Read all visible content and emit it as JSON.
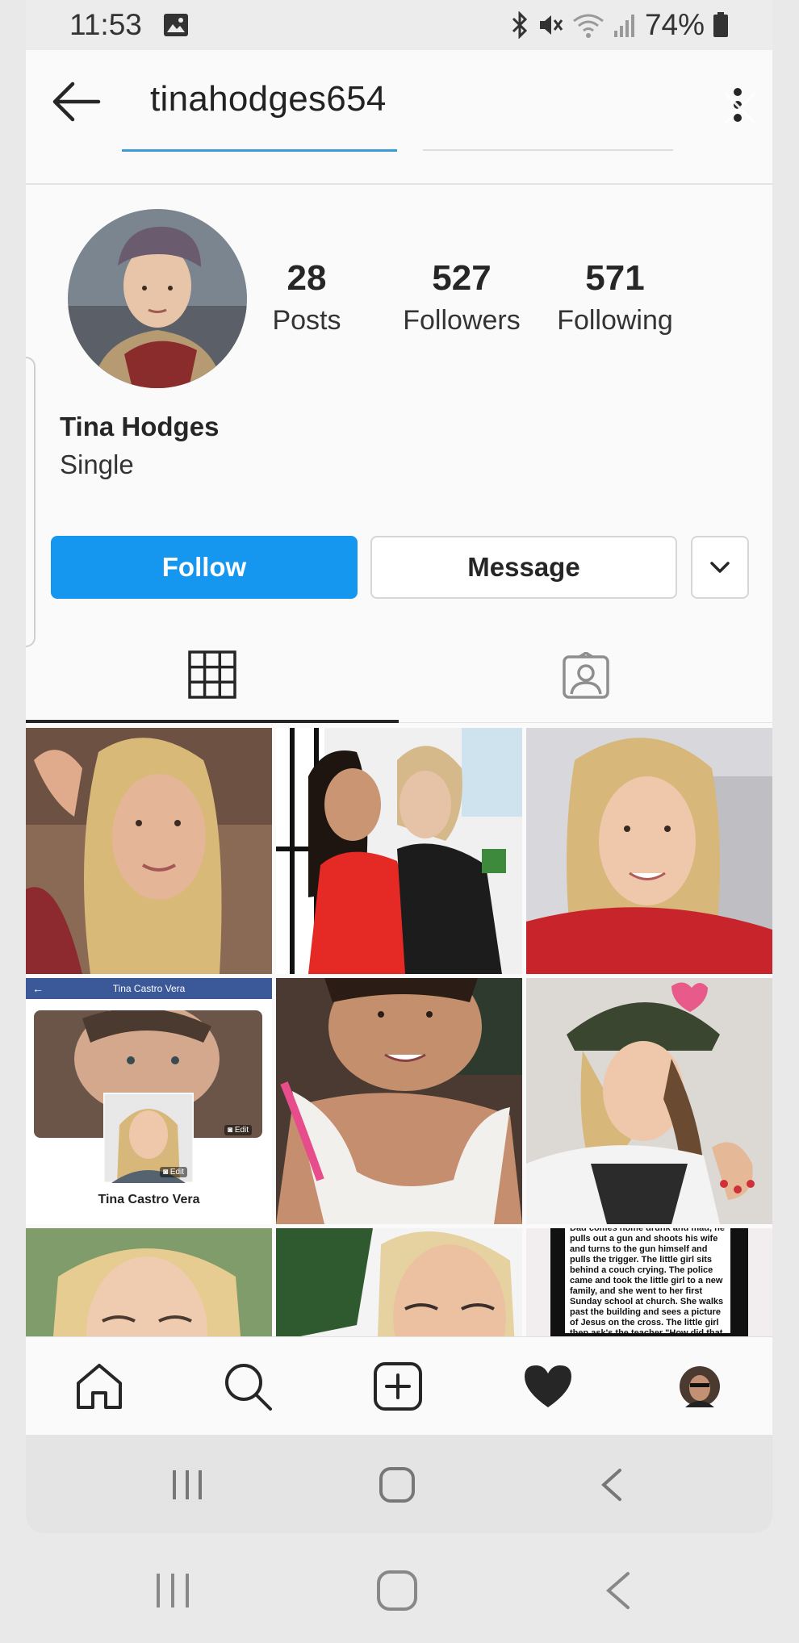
{
  "status_bar": {
    "time": "11:53",
    "battery": "74%"
  },
  "header": {
    "username": "tinahodges654"
  },
  "profile": {
    "name": "Tina Hodges",
    "bio": "Single",
    "stats": [
      {
        "value": "28",
        "label": "Posts"
      },
      {
        "value": "527",
        "label": "Followers"
      },
      {
        "value": "571",
        "label": "Following"
      }
    ]
  },
  "actions": {
    "follow_label": "Follow",
    "message_label": "Message"
  },
  "tabs": [
    "grid-icon",
    "tagged-icon"
  ],
  "posts": {
    "post4_header": "Tina Castro Vera",
    "post4_caption": "Tina Castro Vera",
    "post4_edit1": "Edit",
    "post4_edit2": "Edit",
    "post9_text": "Dad comes home drunk and mad, he pulls out a gun and shoots his wife and turns to the gun himself and pulls the trigger. The little girl sits behind a couch crying. The police came and took the little girl to a new family, and she went to her first Sunday school at church. She walks past the building and sees a picture of Jesus on the cross. The little girl then ask's the teacher \"How did that"
  },
  "bottom_nav": [
    "home-icon",
    "search-icon",
    "new-post-icon",
    "activity-heart-icon",
    "profile-avatar"
  ],
  "colors": {
    "accent": "#1597f0",
    "tab_underline": "#3b9bd6",
    "text": "#262626"
  }
}
